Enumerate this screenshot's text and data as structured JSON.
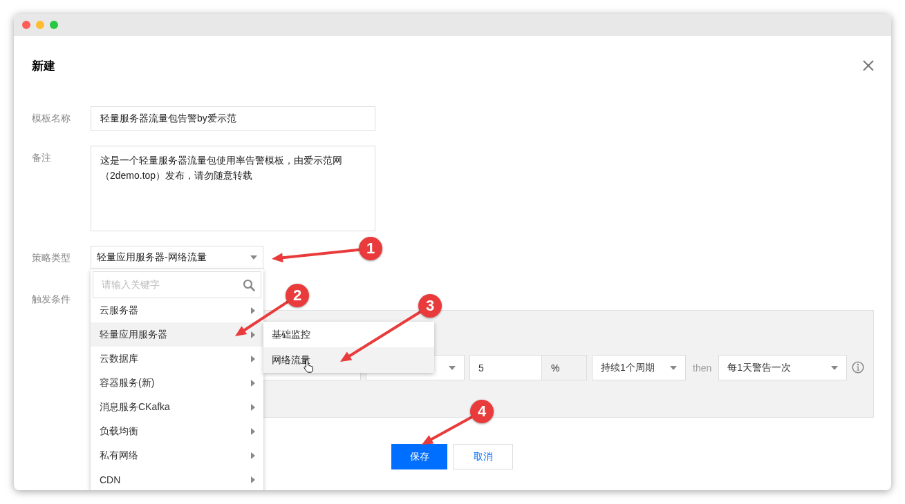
{
  "window": {
    "title": "新建"
  },
  "fields": [
    {
      "label": "模板名称",
      "kind": "input",
      "value": "轻量服务器流量包告警by爱示范"
    },
    {
      "label": "备注",
      "kind": "textarea",
      "value": "这是一个轻量服务器流量包使用率告警模板，由爱示范网（2demo.top）发布，请勿随意转载"
    },
    {
      "label": "策略类型",
      "kind": "select",
      "value": "轻量应用服务器-网络流量"
    }
  ],
  "dropdown": {
    "placeholder": "请输入关键字",
    "items": [
      {
        "label": "云服务器",
        "selected": false
      },
      {
        "label": "轻量应用服务器",
        "selected": true
      },
      {
        "label": "云数据库",
        "selected": false
      },
      {
        "label": "容器服务(新)",
        "selected": false
      },
      {
        "label": "消息服务CKafka",
        "selected": false
      },
      {
        "label": "负载均衡",
        "selected": false
      },
      {
        "label": "私有网络",
        "selected": false
      },
      {
        "label": "CDN",
        "selected": false
      }
    ]
  },
  "submenu": {
    "items": [
      {
        "label": "基础监控",
        "selected": false
      },
      {
        "label": "网络流量",
        "selected": true
      }
    ]
  },
  "trigger": {
    "label": "触发条件",
    "threshold": "5",
    "unit": "%",
    "duration": "持续1个周期",
    "then": "then",
    "frequency": "每1天警告一次"
  },
  "buttons": [
    {
      "label": "保存",
      "kind": "primary"
    },
    {
      "label": "取消",
      "kind": "secondary"
    }
  ],
  "annotations": [
    {
      "number": "1"
    },
    {
      "number": "2"
    },
    {
      "number": "3"
    },
    {
      "number": "4"
    }
  ]
}
